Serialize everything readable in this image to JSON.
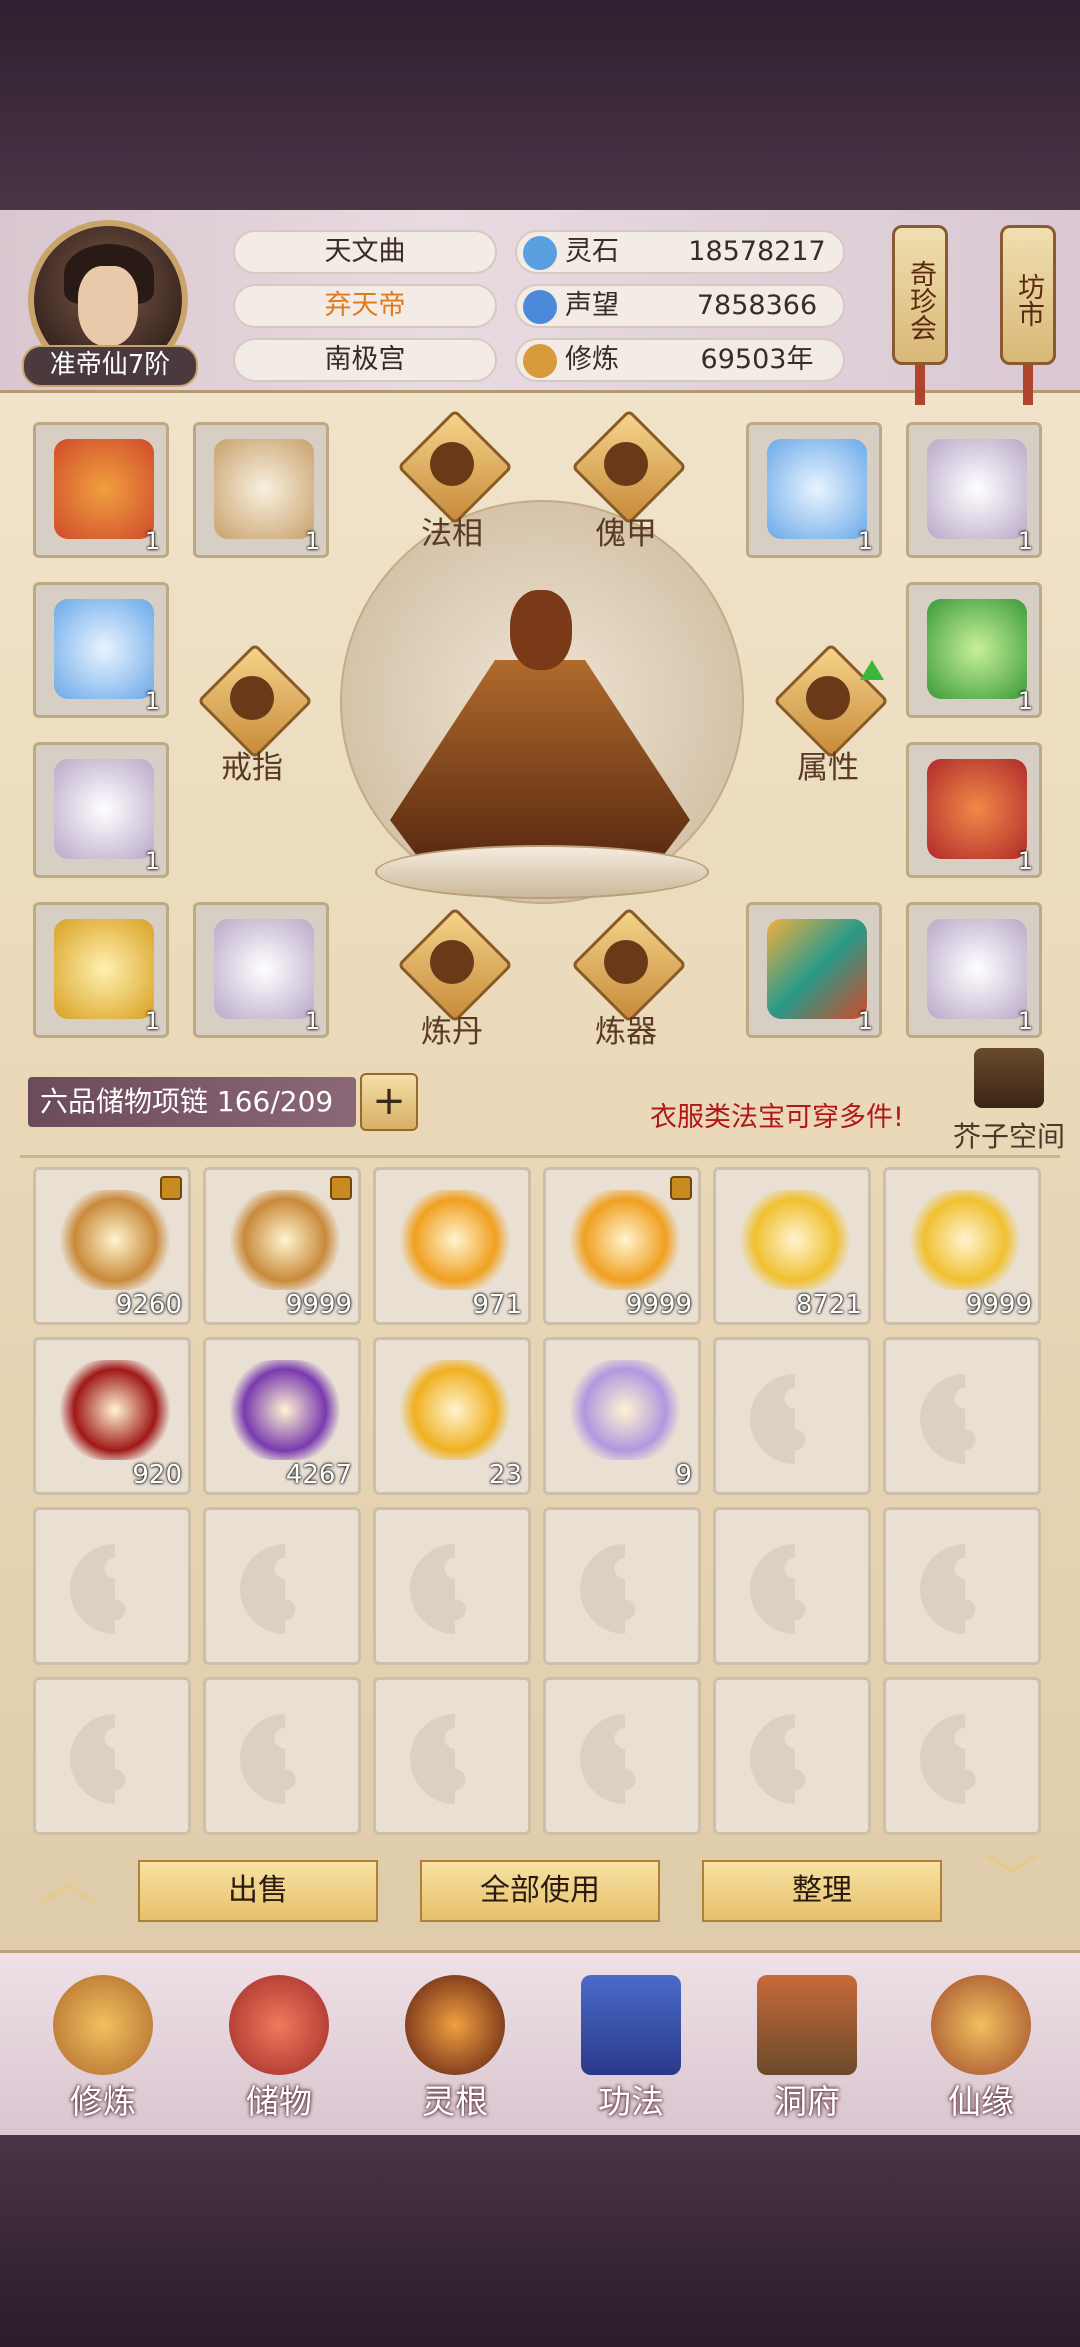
{
  "player": {
    "rank": "准帝仙7阶",
    "titles": [
      "天文曲",
      "弃天帝",
      "南极宫"
    ]
  },
  "resources": [
    {
      "icon": "spirit-stone-icon",
      "label": "灵石",
      "value": "18578217"
    },
    {
      "icon": "reputation-icon",
      "label": "声望",
      "value": "7858366"
    },
    {
      "icon": "cultivation-icon",
      "label": "修炼",
      "value": "69503年"
    }
  ],
  "side_buttons": {
    "treasure_fair": "奇珍会",
    "market": "坊市"
  },
  "equipment": {
    "functions": {
      "dharma_form": "法相",
      "puppet_armor": "傀甲",
      "ring": "戒指",
      "attributes": "属性",
      "alchemy": "炼丹",
      "forging": "炼器"
    },
    "slots": [
      {
        "count": "1",
        "color": "#d04a2a"
      },
      {
        "count": "1",
        "color": "#e8dcc8"
      },
      {
        "count": "1",
        "color": "#9cc8f0"
      },
      {
        "count": "1",
        "color": "#e0d8e8"
      },
      {
        "count": "1",
        "color": "#9cc8f0"
      },
      {
        "count": "1",
        "color": "#7ad04a"
      },
      {
        "count": "1",
        "color": "#e0d8e8"
      },
      {
        "count": "1",
        "color": "#c83a2a"
      },
      {
        "count": "1",
        "color": "#f0c840"
      },
      {
        "count": "1",
        "color": "#e0d8e8"
      },
      {
        "count": "1",
        "color": "#d8743a"
      },
      {
        "count": "1",
        "color": "#e0d8e8"
      }
    ]
  },
  "bag": {
    "name": "六品储物项链",
    "capacity": "166/209",
    "expand_label": "+",
    "tip": "衣服类法宝可穿多件!",
    "space_label": "芥子空间"
  },
  "inventory": [
    {
      "count": "9260",
      "locked": true,
      "color": "#c98a3a"
    },
    {
      "count": "9999",
      "locked": true,
      "color": "#c98a3a"
    },
    {
      "count": "971",
      "locked": false,
      "color": "#f0a020"
    },
    {
      "count": "9999",
      "locked": true,
      "color": "#f0a020"
    },
    {
      "count": "8721",
      "locked": false,
      "color": "#f0c030"
    },
    {
      "count": "9999",
      "locked": false,
      "color": "#f0c030"
    },
    {
      "count": "920",
      "locked": false,
      "color": "#a01818"
    },
    {
      "count": "4267",
      "locked": false,
      "color": "#7a3ab0"
    },
    {
      "count": "23",
      "locked": false,
      "color": "#f0b020"
    },
    {
      "count": "9",
      "locked": false,
      "color": "#b098e0"
    }
  ],
  "inventory_empty_slots": 14,
  "actions": {
    "sell": "出售",
    "use_all": "全部使用",
    "sort": "整理"
  },
  "nav": [
    {
      "icon": "cultivate-icon",
      "label": "修炼"
    },
    {
      "icon": "storage-bag-icon",
      "label": "储物"
    },
    {
      "icon": "spirit-root-icon",
      "label": "灵根"
    },
    {
      "icon": "technique-book-icon",
      "label": "功法"
    },
    {
      "icon": "cave-mansion-icon",
      "label": "洞府"
    },
    {
      "icon": "immortal-fate-icon",
      "label": "仙缘"
    }
  ]
}
